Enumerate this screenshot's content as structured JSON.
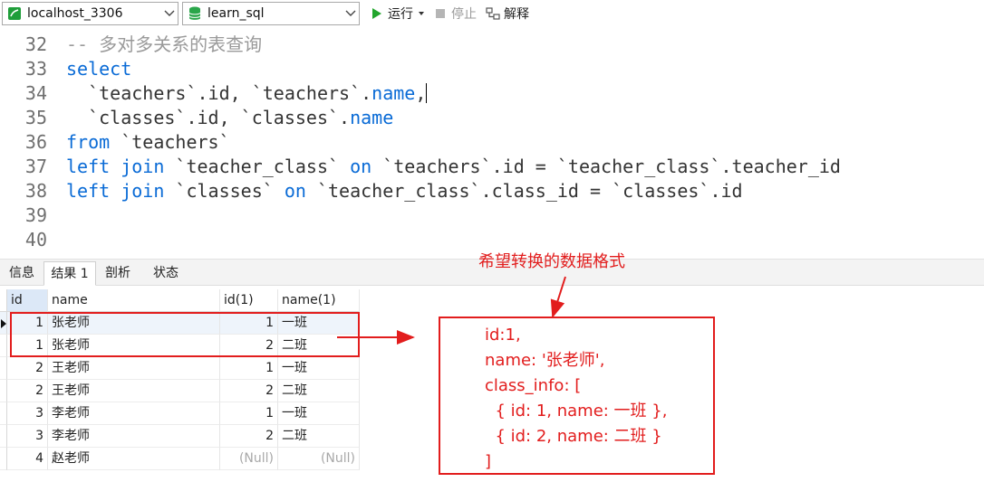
{
  "toolbar": {
    "connection": "localhost_3306",
    "database": "learn_sql",
    "run_label": "运行",
    "stop_label": "停止",
    "explain_label": "解释"
  },
  "editor": {
    "lines": [
      {
        "num": "32",
        "parts": [
          {
            "t": "-- 多对多关系的表查询",
            "c": "cm"
          }
        ]
      },
      {
        "num": "33",
        "parts": [
          {
            "t": "select",
            "c": "kw"
          }
        ]
      },
      {
        "num": "34",
        "parts": [
          {
            "t": "  `teachers`.id, `teachers`.",
            "c": ""
          },
          {
            "t": "name",
            "c": "kw"
          },
          {
            "t": ",",
            "c": ""
          }
        ],
        "cursor": true
      },
      {
        "num": "35",
        "parts": [
          {
            "t": "  `classes`.id, `classes`.",
            "c": ""
          },
          {
            "t": "name",
            "c": "kw"
          }
        ]
      },
      {
        "num": "36",
        "parts": [
          {
            "t": "from",
            "c": "kw"
          },
          {
            "t": " `teachers`",
            "c": ""
          }
        ]
      },
      {
        "num": "37",
        "parts": [
          {
            "t": "left join",
            "c": "kw"
          },
          {
            "t": " `teacher_class` ",
            "c": ""
          },
          {
            "t": "on",
            "c": "kw"
          },
          {
            "t": " `teachers`.id = `teacher_class`.teacher_id",
            "c": ""
          }
        ]
      },
      {
        "num": "38",
        "parts": [
          {
            "t": "left join",
            "c": "kw"
          },
          {
            "t": " `classes` ",
            "c": ""
          },
          {
            "t": "on",
            "c": "kw"
          },
          {
            "t": " `teacher_class`.class_id = `classes`.id",
            "c": ""
          }
        ]
      },
      {
        "num": "39",
        "parts": []
      },
      {
        "num": "40",
        "parts": []
      }
    ]
  },
  "tabs": [
    {
      "label": "信息",
      "active": false
    },
    {
      "label": "结果 1",
      "active": true
    },
    {
      "label": "剖析",
      "active": false
    },
    {
      "label": "状态",
      "active": false
    }
  ],
  "grid": {
    "columns": [
      "id",
      "name",
      "id(1)",
      "name(1)"
    ],
    "rows": [
      [
        "1",
        "张老师",
        "1",
        "一班"
      ],
      [
        "1",
        "张老师",
        "2",
        "二班"
      ],
      [
        "2",
        "王老师",
        "1",
        "一班"
      ],
      [
        "2",
        "王老师",
        "2",
        "二班"
      ],
      [
        "3",
        "李老师",
        "1",
        "一班"
      ],
      [
        "3",
        "李老师",
        "2",
        "二班"
      ],
      [
        "4",
        "赵老师",
        "(Null)",
        "(Null)"
      ]
    ]
  },
  "annotation": {
    "title": "希望转换的数据格式",
    "lines": [
      "id:1,",
      "name: '张老师',",
      "class_info: [",
      "  { id: 1, name: 一班 },",
      "  { id: 2, name: 二班 }",
      "]"
    ],
    "color": "#e21d1d"
  },
  "colors": {
    "keyword": "#0a6bd6",
    "comment": "#9a9a9a",
    "null_text": "#a8a8a8",
    "run_green": "#22a52c"
  }
}
